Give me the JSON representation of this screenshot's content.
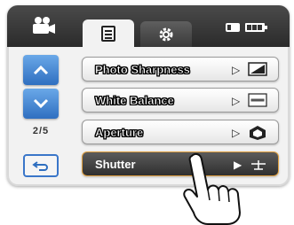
{
  "tabs": [
    {
      "name": "menu-tab",
      "icon": "menu-list-icon",
      "active": true
    },
    {
      "name": "settings-tab",
      "icon": "gear-icon",
      "active": false
    }
  ],
  "status": {
    "icons": [
      "memory-card-icon",
      "battery-icon"
    ]
  },
  "nav": {
    "page_counter": "2/5"
  },
  "menu": {
    "items": [
      {
        "label": "Photo Sharpness",
        "icon": "sharpness-icon",
        "selected": false
      },
      {
        "label": "White Balance",
        "icon": "white-balance-awb-icon",
        "selected": false
      },
      {
        "label": "Aperture",
        "icon": "aperture-auto-icon",
        "selected": false
      },
      {
        "label": "Shutter",
        "icon": "shutter-auto-icon",
        "selected": true
      }
    ]
  },
  "colors": {
    "accent_blue": "#2f6fc0",
    "selected_border": "#e0a040",
    "topbar": "#2b2b2b"
  }
}
